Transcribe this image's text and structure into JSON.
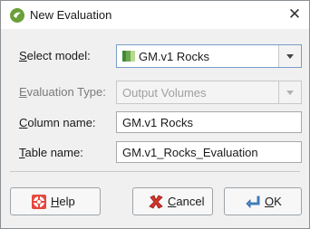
{
  "window": {
    "title": "New Evaluation",
    "close_glyph": "✕"
  },
  "form": {
    "select_model": {
      "label_u": "S",
      "label_rest": "elect model:",
      "value": "GM.v1 Rocks",
      "icon": "geological-model-icon"
    },
    "evaluation_type": {
      "label_u": "E",
      "label_rest": "valuation Type:",
      "value": "Output Volumes",
      "disabled": true
    },
    "column_name": {
      "label_u": "C",
      "label_rest": "olumn name:",
      "value": "GM.v1 Rocks"
    },
    "table_name": {
      "label_u": "T",
      "label_rest": "able name:",
      "value": "GM.v1_Rocks_Evaluation"
    }
  },
  "buttons": {
    "help": {
      "label_u": "H",
      "label_rest": "elp",
      "icon": "lifebuoy-icon"
    },
    "cancel": {
      "label_u": "C",
      "label_rest": "ancel",
      "icon": "red-x-icon"
    },
    "ok": {
      "label_u": "O",
      "label_rest": "K",
      "icon": "enter-arrow-icon"
    }
  },
  "colors": {
    "accent_border": "#7a9cc8",
    "app_icon": "#6a9f3a",
    "cancel_red": "#d8342b"
  }
}
